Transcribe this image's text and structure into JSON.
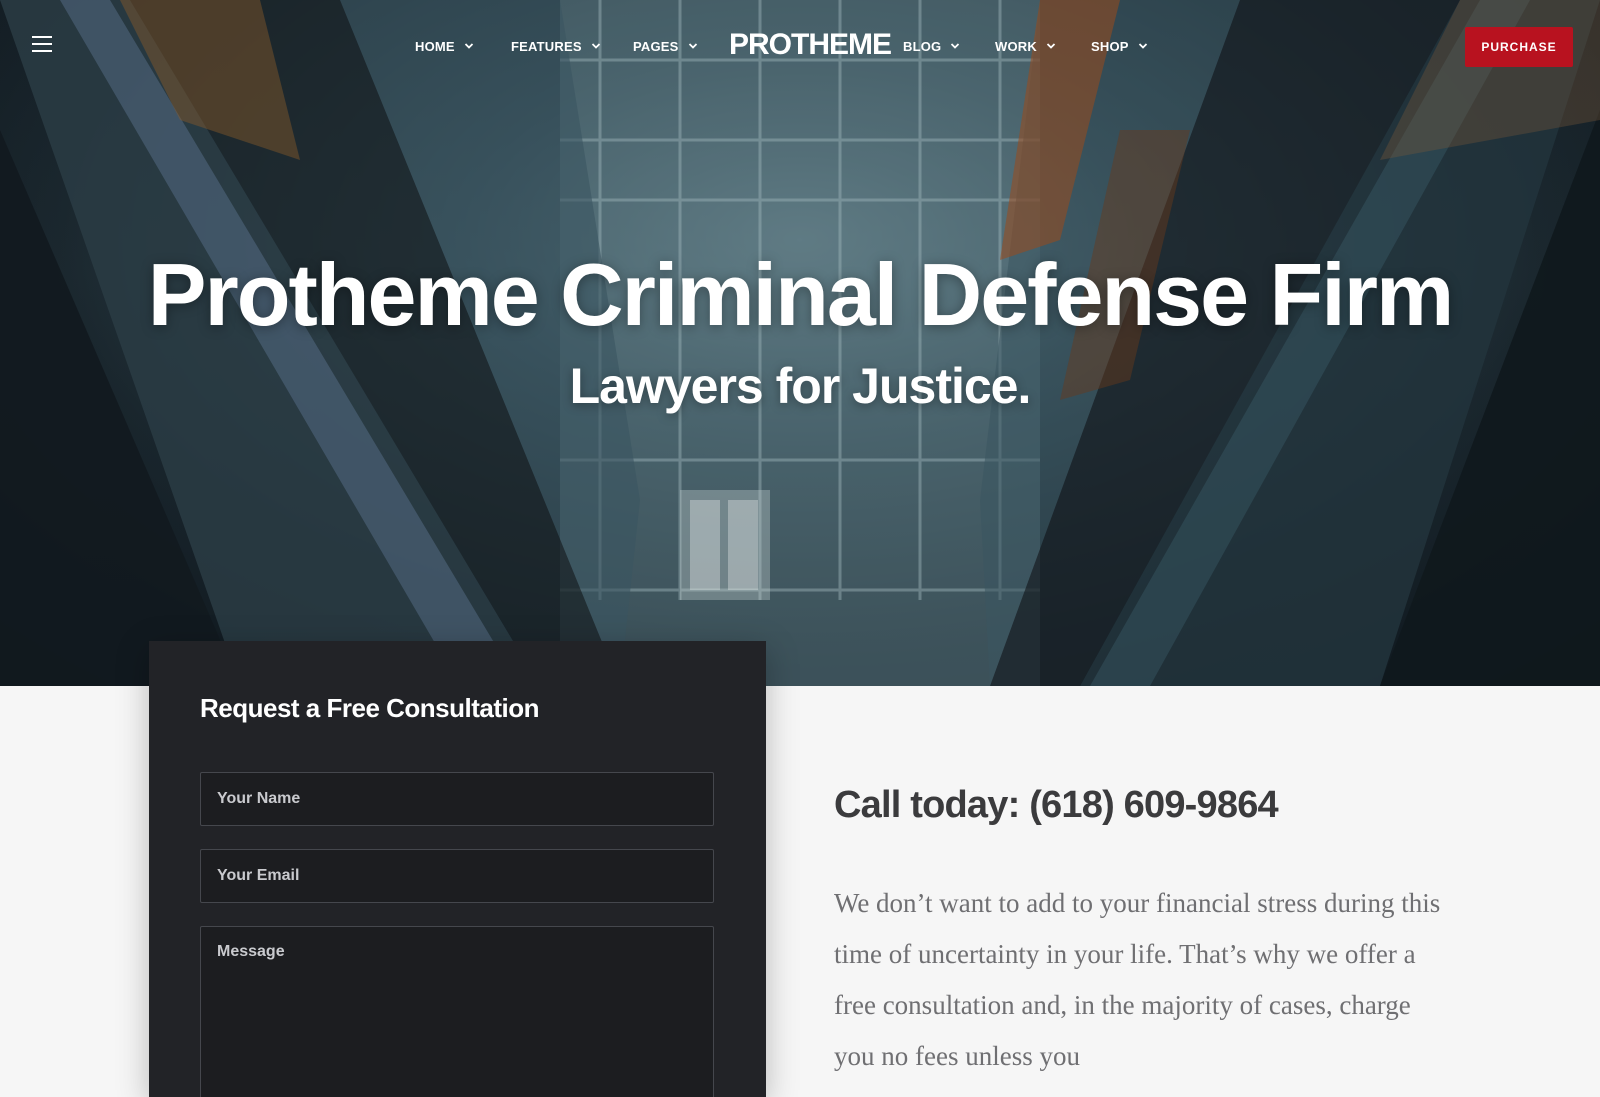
{
  "nav": {
    "menu_icon": "hamburger-icon",
    "items": [
      {
        "label": "HOME",
        "icon": "chevron-down-icon"
      },
      {
        "label": "FEATURES",
        "icon": "chevron-down-icon"
      },
      {
        "label": "PAGES",
        "icon": "chevron-down-icon"
      },
      {
        "label": "BLOG",
        "icon": "chevron-down-icon"
      },
      {
        "label": "WORK",
        "icon": "chevron-down-icon"
      },
      {
        "label": "SHOP",
        "icon": "chevron-down-icon"
      }
    ],
    "logo": "PROTHEME",
    "purchase_label": "PURCHASE"
  },
  "hero": {
    "title": "Protheme Criminal Defense Firm",
    "subtitle": "Lawyers for Justice."
  },
  "form": {
    "title": "Request a Free Consultation",
    "name_placeholder": "Your Name",
    "email_placeholder": "Your Email",
    "message_placeholder": "Message"
  },
  "content": {
    "call_heading": "Call today: (618) 609-9864",
    "body": "We don’t want to add to your financial stress during this time of uncertainty in your life. That’s why we offer a free consultation and, in the majority of cases, charge you no fees unless you"
  },
  "colors": {
    "accent": "#b8121f",
    "form_bg": "#222327",
    "page_bg": "#f6f6f6",
    "heading": "#3b3b3d",
    "body_text": "#6f6f72"
  }
}
